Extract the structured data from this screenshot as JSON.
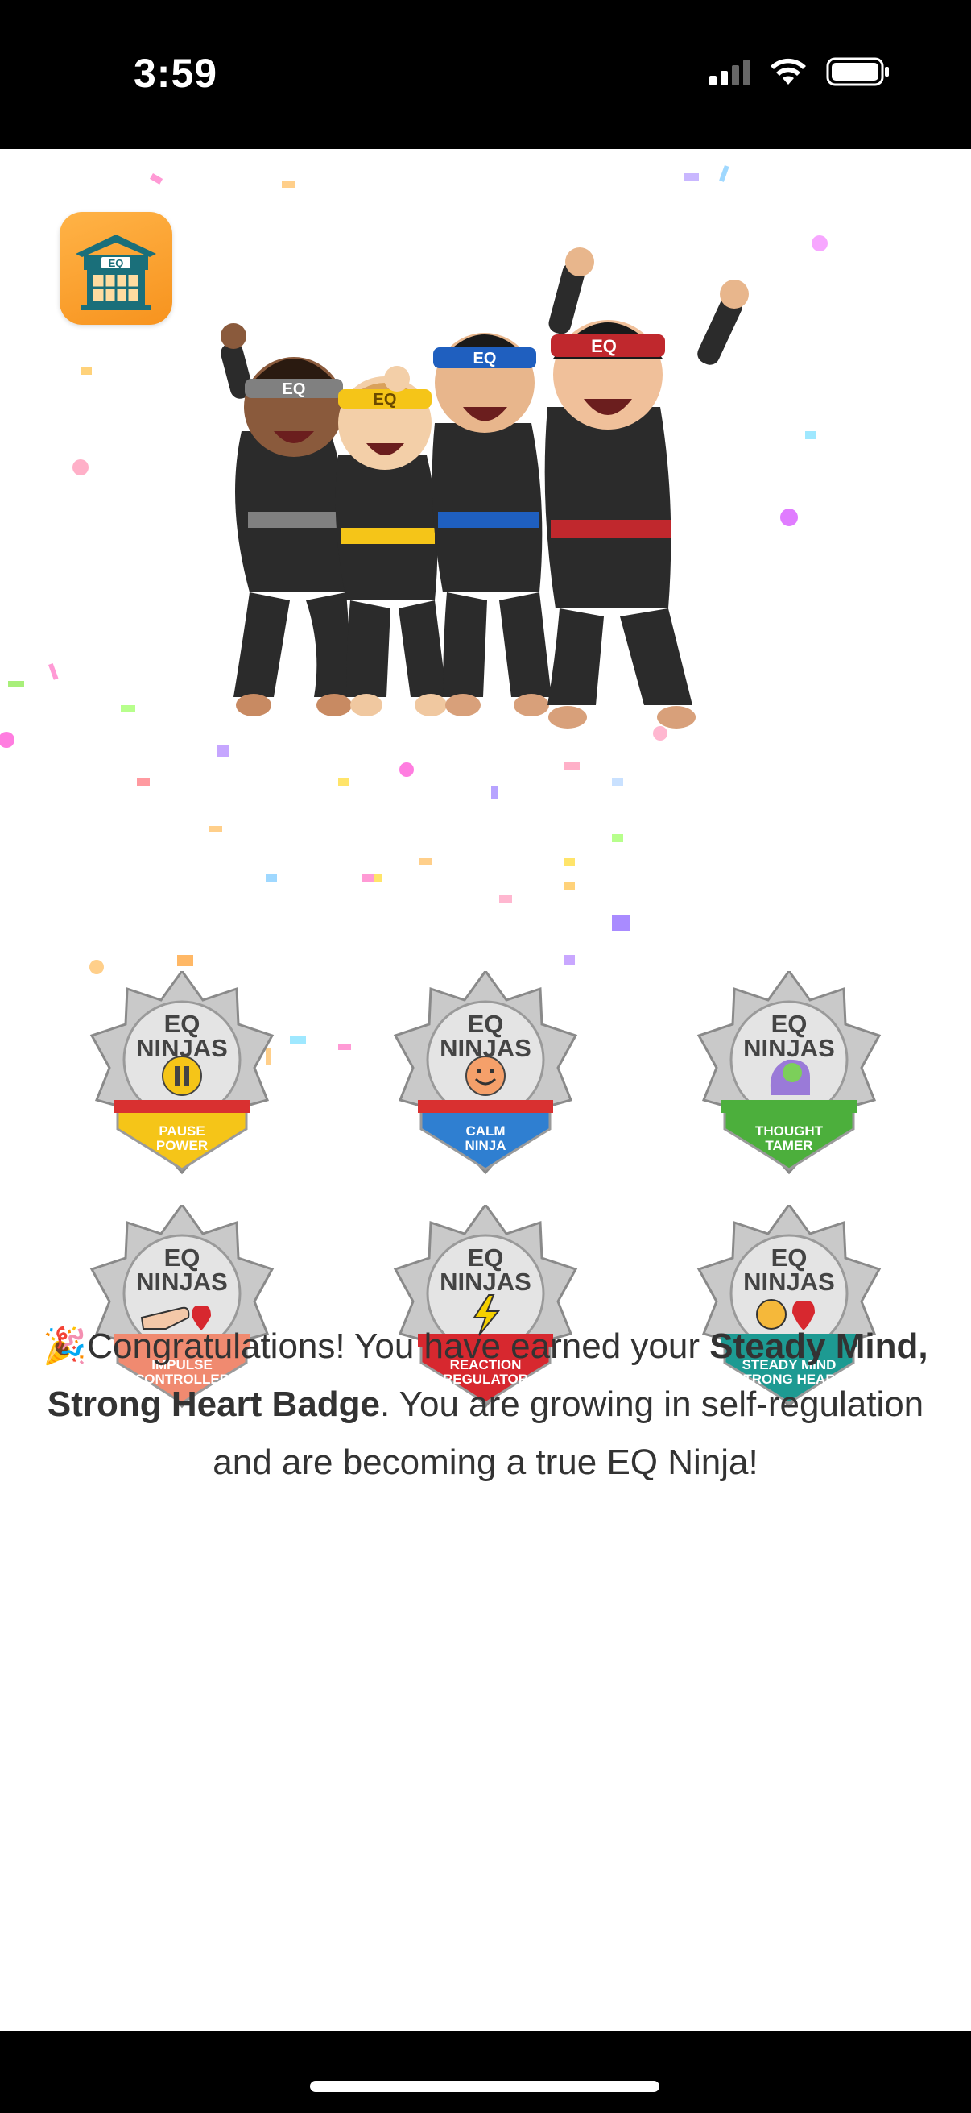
{
  "status_bar": {
    "time": "3:59",
    "icons": [
      "cellular-signal-icon",
      "wifi-icon",
      "battery-icon"
    ]
  },
  "app": {
    "icon_label": "EQ",
    "icon_name": "dojo-icon"
  },
  "hero": {
    "headband_text": "EQ",
    "belt_colors": [
      "#808080",
      "#f5c518",
      "#1f5fbf",
      "#c0282d"
    ]
  },
  "badges": [
    {
      "title_line1": "EQ",
      "title_line2": "NINJAS",
      "label_line1": "PAUSE",
      "label_line2": "POWER",
      "icon": "pause-icon",
      "color": "#f5c518"
    },
    {
      "title_line1": "EQ",
      "title_line2": "NINJAS",
      "label_line1": "CALM",
      "label_line2": "NINJA",
      "icon": "smile-icon",
      "color": "#2f7fd1"
    },
    {
      "title_line1": "EQ",
      "title_line2": "NINJAS",
      "label_line1": "THOUGHT",
      "label_line2": "TAMER",
      "icon": "brain-head-icon",
      "color": "#4caf3c"
    },
    {
      "title_line1": "EQ",
      "title_line2": "NINJAS",
      "label_line1": "IMPULSE",
      "label_line2": "CONTROLLER",
      "icon": "hand-heart-icon",
      "color": "#f08a70"
    },
    {
      "title_line1": "EQ",
      "title_line2": "NINJAS",
      "label_line1": "REACTION",
      "label_line2": "REGULATOR",
      "icon": "lightning-icon",
      "color": "#d7282f"
    },
    {
      "title_line1": "EQ",
      "title_line2": "NINJAS",
      "label_line1": "STEADY MIND",
      "label_line2": "STRONG HEART",
      "icon": "brain-heart-icon",
      "color": "#1d9a92"
    }
  ],
  "message": {
    "emoji": "🎉",
    "prefix": "Congratulations! You have earned your ",
    "badge_name": "Steady Mind, Strong Heart Badge",
    "suffix": ". You are growing in self-regulation and are becoming a true EQ Ninja!"
  }
}
